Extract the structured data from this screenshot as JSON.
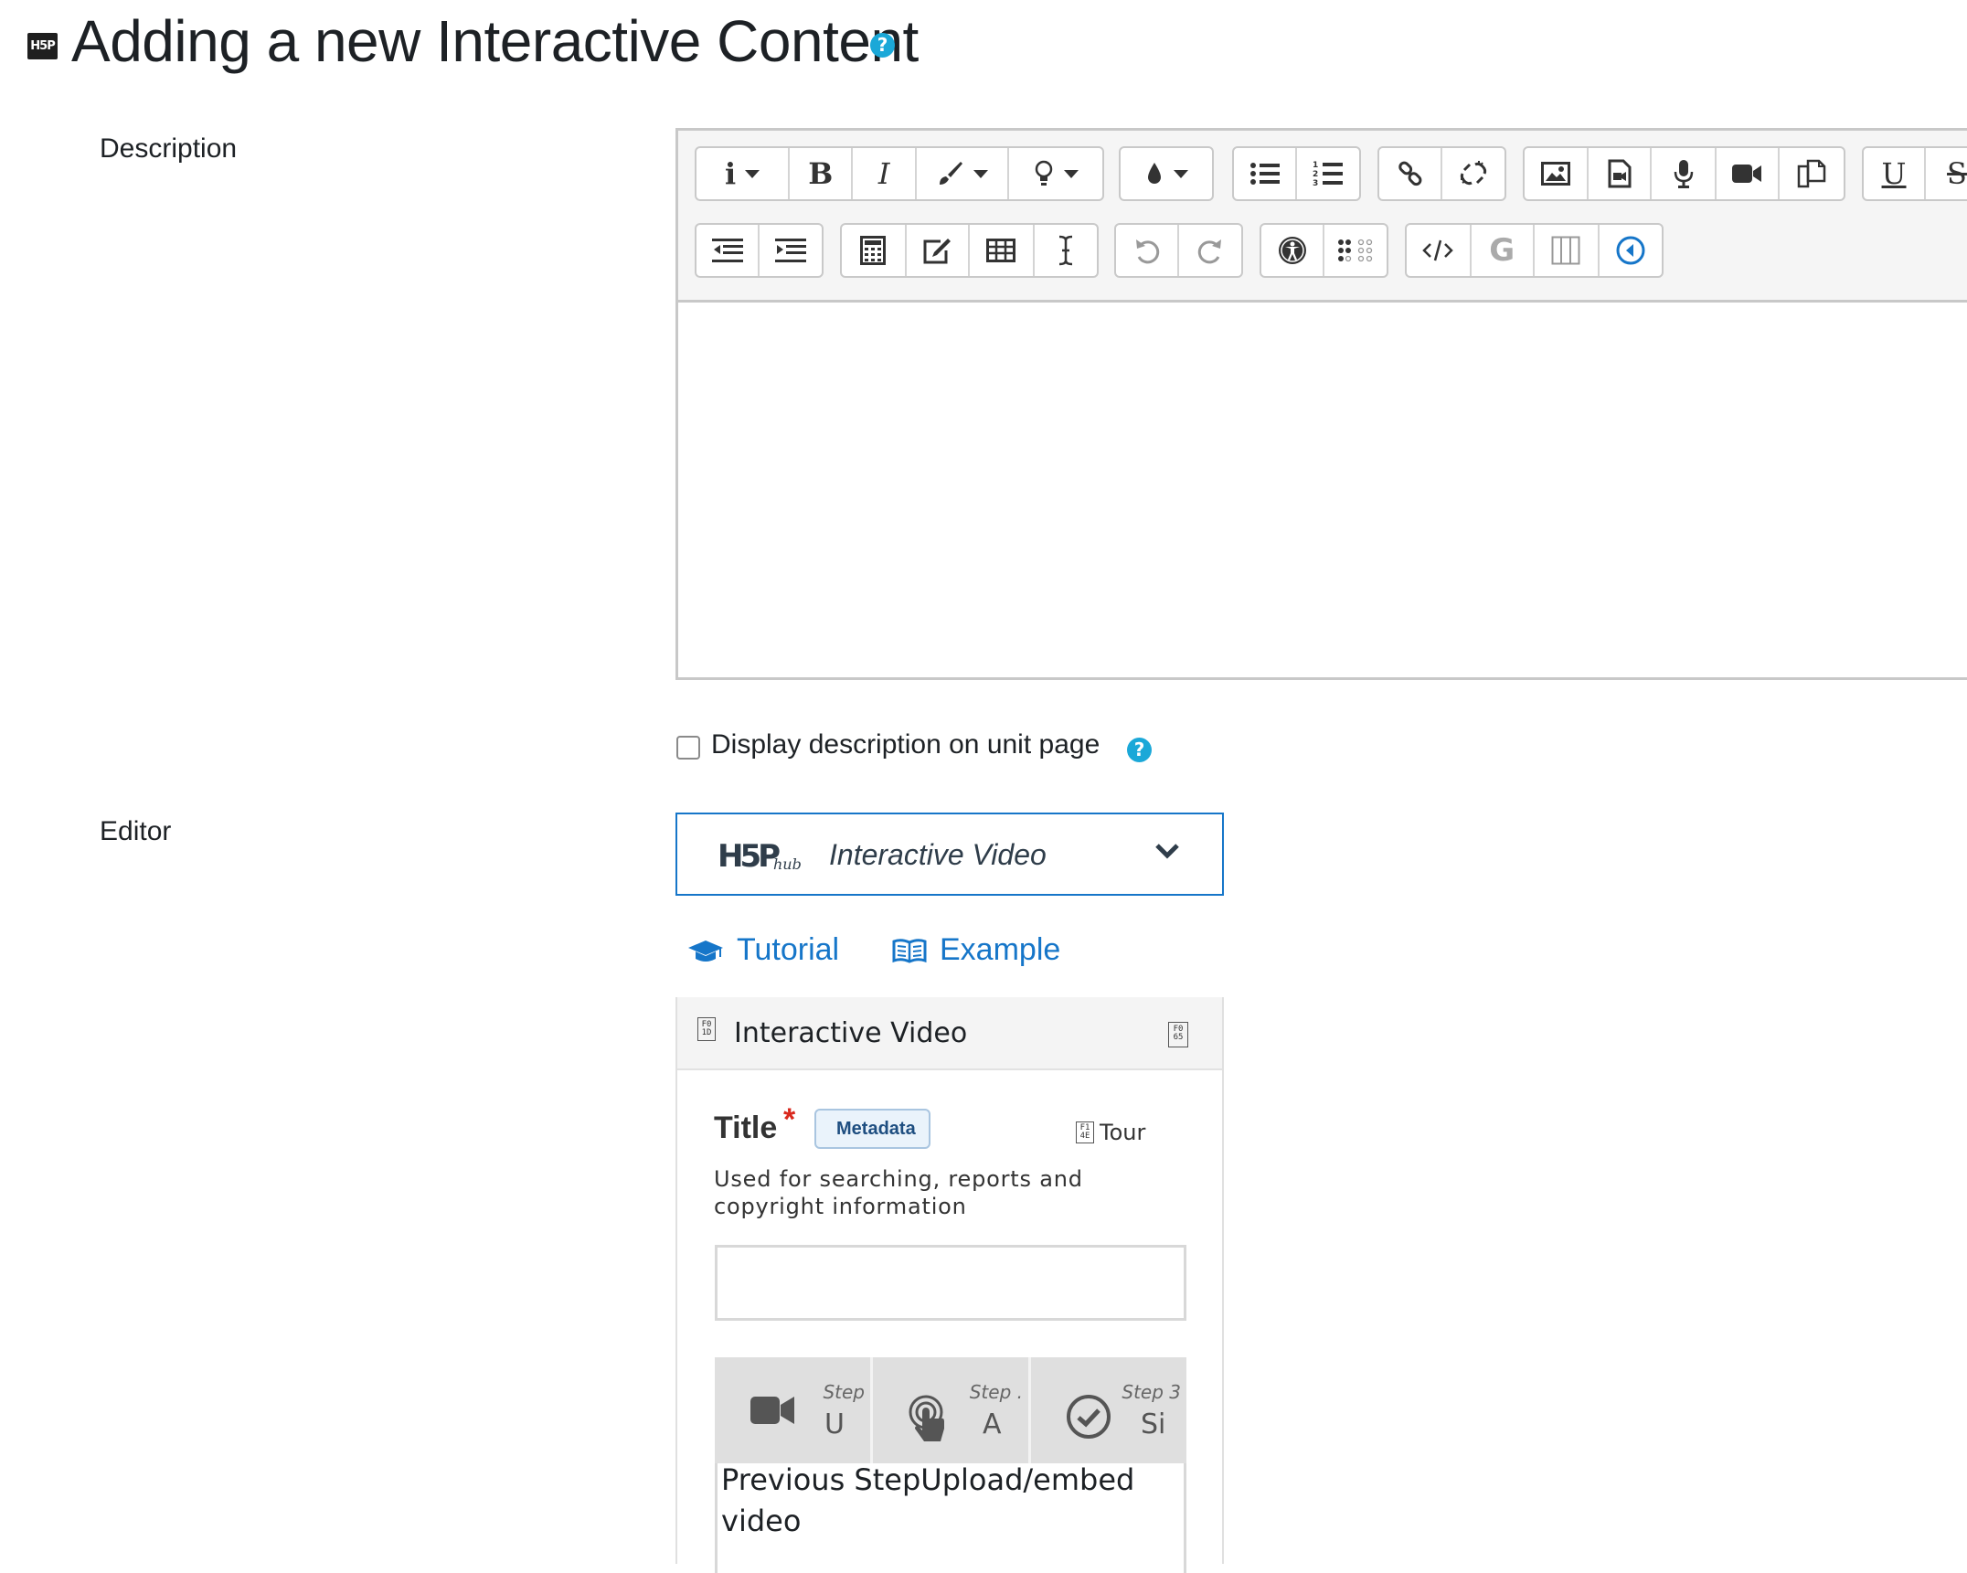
{
  "header": {
    "icon_label": "H5P",
    "title": "Adding a new Interactive Content",
    "help_glyph": "?"
  },
  "form": {
    "description_label": "Description",
    "editor_label": "Editor",
    "display_description_label": "Display description on unit page",
    "display_description_checked": false
  },
  "toolbar": {
    "row1": [
      "info-menu",
      "bold",
      "italic",
      "style-brush-menu",
      "lightbulb-menu",
      "color-drop-menu",
      "bullet-list",
      "numbered-list",
      "link",
      "unlink",
      "image",
      "media-file",
      "record-audio",
      "record-video",
      "manage-files",
      "underline",
      "strikethrough"
    ],
    "row2": [
      "outdent",
      "indent",
      "equation",
      "edit-math",
      "table",
      "cursor-text",
      "undo",
      "redo",
      "accessibility",
      "braille",
      "html-source",
      "grammar",
      "columns",
      "recit"
    ]
  },
  "hub": {
    "logo": "H5P",
    "logo_sub": "hub",
    "selected_content_type": "Interactive Video"
  },
  "links": {
    "tutorial": "Tutorial",
    "example": "Example"
  },
  "panel": {
    "title": "Interactive Video",
    "tofu_left": "F0 1D",
    "tofu_right": "F0 65",
    "field_title": "Title",
    "required_mark": "*",
    "metadata_label": "Metadata",
    "tour_label": "Tour",
    "tofu_tour": "F1 4E",
    "title_description": "Used for searching, reports and copyright information",
    "title_value": "",
    "steps": [
      {
        "step_label": "Step",
        "letter": "U",
        "icon": "video-camera-icon"
      },
      {
        "step_label": "Step .",
        "letter": "A",
        "icon": "touch-hand-icon"
      },
      {
        "step_label": "Step 3",
        "letter": "Si",
        "icon": "check-circle-icon"
      }
    ],
    "step_text": "Previous StepUpload/embed video"
  },
  "colors": {
    "accent_blue": "#1676c9",
    "help_cyan": "#1ba8d8",
    "required_red": "#d9281d"
  }
}
